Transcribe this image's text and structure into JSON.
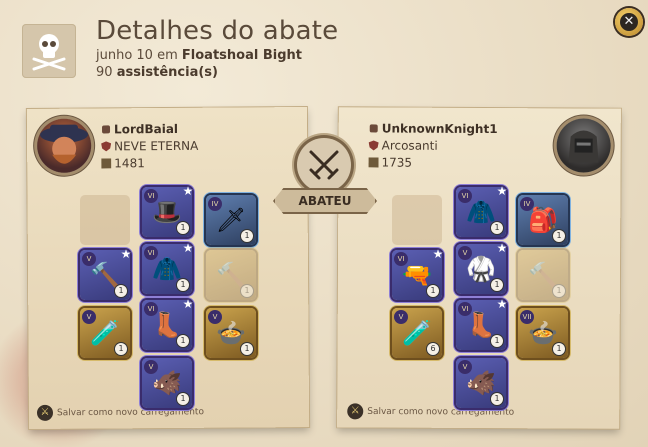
{
  "header": {
    "title": "Detalhes do abate",
    "date_prefix": "junho 10 em",
    "location": "Floatshoal Bight",
    "assists_count": "90",
    "assists_label": "assistência(s)"
  },
  "center": {
    "label": "ABATEU"
  },
  "killer": {
    "name": "LordBaial",
    "guild": "NEVE ETERNA",
    "ip": "1481",
    "footer": "Salvar como novo carregamento",
    "slots": [
      {
        "id": "bag",
        "state": "empty",
        "glyph": "",
        "quality": ""
      },
      {
        "id": "head",
        "state": "t6",
        "glyph": "🎩",
        "quality": "1",
        "tier": "VI",
        "star": "★"
      },
      {
        "id": "cape",
        "state": "t4",
        "glyph": "🗡",
        "quality": "1",
        "tier": "IV"
      },
      {
        "id": "mainhand",
        "state": "t6",
        "glyph": "🔨",
        "quality": "1",
        "tier": "V",
        "star": "★"
      },
      {
        "id": "armor",
        "state": "t6",
        "glyph": "🧥",
        "quality": "1",
        "tier": "VI",
        "star": "★"
      },
      {
        "id": "offhand",
        "state": "faded",
        "glyph": "🔨",
        "quality": "1"
      },
      {
        "id": "potion",
        "state": "t5",
        "glyph": "🧪",
        "quality": "1",
        "tier": "V"
      },
      {
        "id": "shoes",
        "state": "t6",
        "glyph": "👢",
        "quality": "1",
        "tier": "VI",
        "star": "★"
      },
      {
        "id": "food",
        "state": "t5",
        "glyph": "🍲",
        "quality": "1",
        "tier": "V"
      },
      {
        "id": "mount",
        "state": "t6",
        "glyph": "🐗",
        "quality": "1",
        "tier": "V"
      }
    ]
  },
  "victim": {
    "name": "UnknownKnight1",
    "guild": "Arcosanti",
    "ip": "1735",
    "footer": "Salvar como novo carregamento",
    "slots": [
      {
        "id": "bag",
        "state": "empty",
        "glyph": "",
        "quality": ""
      },
      {
        "id": "head",
        "state": "t6",
        "glyph": "🧥",
        "quality": "1",
        "tier": "VI",
        "star": "★"
      },
      {
        "id": "cape",
        "state": "t4",
        "glyph": "🎒",
        "quality": "1",
        "tier": "IV"
      },
      {
        "id": "mainhand",
        "state": "t6",
        "glyph": "🔫",
        "quality": "1",
        "tier": "VI",
        "star": "★"
      },
      {
        "id": "armor",
        "state": "t6",
        "glyph": "🥋",
        "quality": "1",
        "tier": "V",
        "star": "★"
      },
      {
        "id": "offhand",
        "state": "faded",
        "glyph": "🔨",
        "quality": "1"
      },
      {
        "id": "potion",
        "state": "t5",
        "glyph": "🧪",
        "quality": "6",
        "tier": "V"
      },
      {
        "id": "shoes",
        "state": "t6",
        "glyph": "👢",
        "quality": "1",
        "tier": "VI",
        "star": "★"
      },
      {
        "id": "food",
        "state": "t5",
        "glyph": "🍲",
        "quality": "1",
        "tier": "VII"
      },
      {
        "id": "mount",
        "state": "t6",
        "glyph": "🐗",
        "quality": "1",
        "tier": "V"
      }
    ]
  },
  "colors": {
    "text_dark": "#3e3025",
    "parchment": "#ebdcbf",
    "tier_purple": "#8e7fd6",
    "tier_gold": "#d6ba6a",
    "tier_blue": "#7fb2e0"
  }
}
